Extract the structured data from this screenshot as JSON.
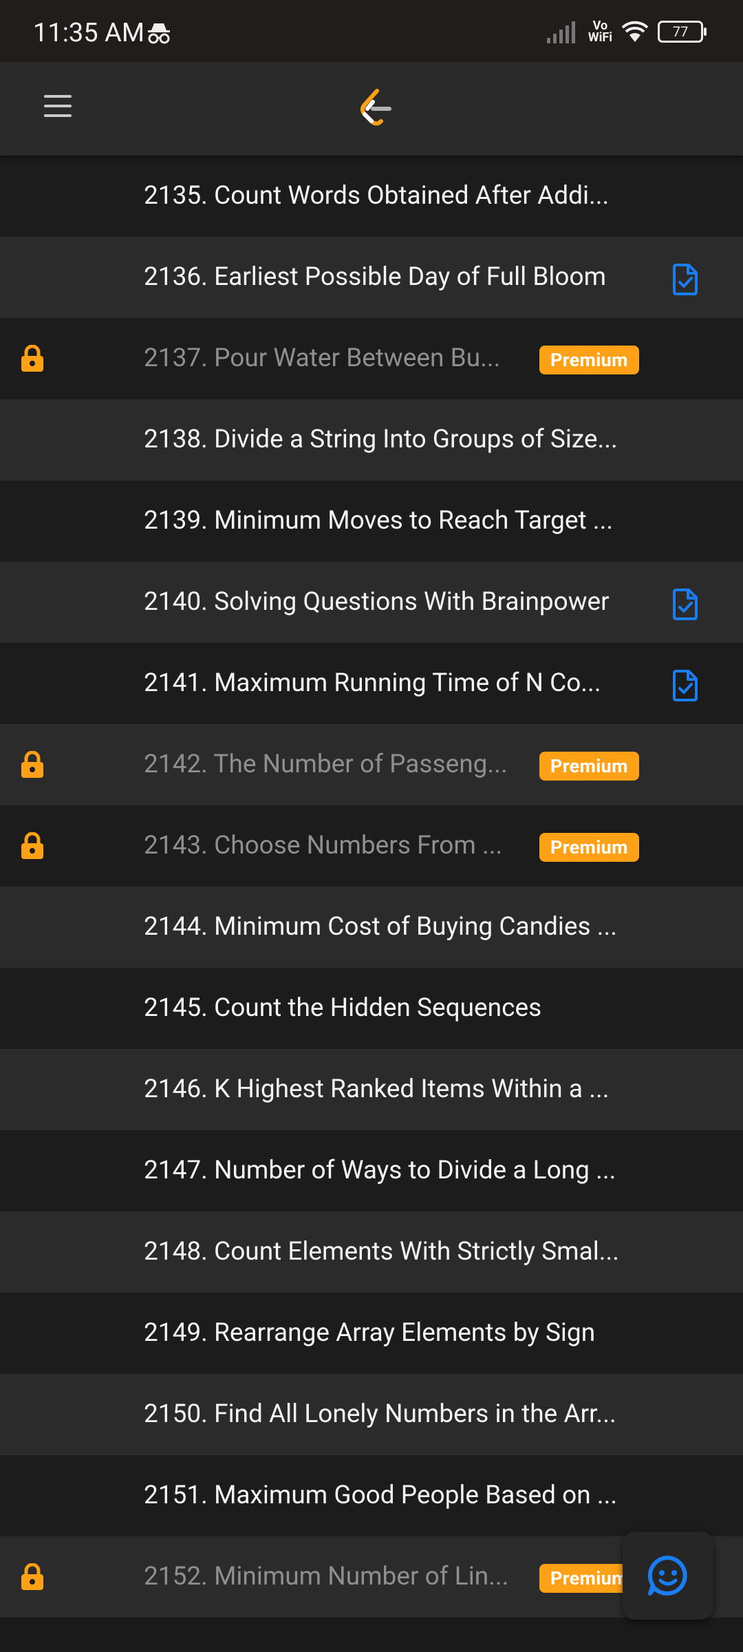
{
  "status": {
    "time": "11:35 AM",
    "vowifi_top": "Vo",
    "vowifi_bottom": "WiFi",
    "battery": "77"
  },
  "toolbar": {
    "menu_icon": "hamburger-menu-icon",
    "logo": "leetcode-logo"
  },
  "problems": [
    {
      "title": "2135. Count Words Obtained After Addi...",
      "locked": false,
      "premium": "",
      "solved": false
    },
    {
      "title": "2136. Earliest Possible Day of Full Bloom",
      "locked": false,
      "premium": "",
      "solved": true
    },
    {
      "title": "2137. Pour Water Between Bu...",
      "locked": true,
      "premium": "Premium",
      "solved": false
    },
    {
      "title": "2138. Divide a String Into Groups of Size...",
      "locked": false,
      "premium": "",
      "solved": false
    },
    {
      "title": "2139. Minimum Moves to Reach Target ...",
      "locked": false,
      "premium": "",
      "solved": false
    },
    {
      "title": "2140. Solving Questions With Brainpower",
      "locked": false,
      "premium": "",
      "solved": true
    },
    {
      "title": "2141. Maximum Running Time of N Co...",
      "locked": false,
      "premium": "",
      "solved": true
    },
    {
      "title": "2142. The Number of Passeng...",
      "locked": true,
      "premium": "Premium",
      "solved": false
    },
    {
      "title": "2143. Choose Numbers From ...",
      "locked": true,
      "premium": "Premium",
      "solved": false
    },
    {
      "title": "2144. Minimum Cost of Buying Candies ...",
      "locked": false,
      "premium": "",
      "solved": false
    },
    {
      "title": "2145. Count the Hidden Sequences",
      "locked": false,
      "premium": "",
      "solved": false
    },
    {
      "title": "2146. K Highest Ranked Items Within a ...",
      "locked": false,
      "premium": "",
      "solved": false
    },
    {
      "title": "2147. Number of Ways to Divide a Long ...",
      "locked": false,
      "premium": "",
      "solved": false
    },
    {
      "title": "2148. Count Elements With Strictly Smal...",
      "locked": false,
      "premium": "",
      "solved": false
    },
    {
      "title": "2149. Rearrange Array Elements by Sign",
      "locked": false,
      "premium": "",
      "solved": false
    },
    {
      "title": "2150. Find All Lonely Numbers in the Arr...",
      "locked": false,
      "premium": "",
      "solved": false
    },
    {
      "title": "2151. Maximum Good People Based on ...",
      "locked": false,
      "premium": "",
      "solved": false
    },
    {
      "title": "2152. Minimum Number of Lin...",
      "locked": true,
      "premium": "Premium",
      "solved": false
    }
  ],
  "fab": {
    "icon": "smiley-feedback-icon"
  },
  "colors": {
    "premium": "#ffa116",
    "lock": "#ffa116",
    "solved": "#1a7ef2"
  }
}
